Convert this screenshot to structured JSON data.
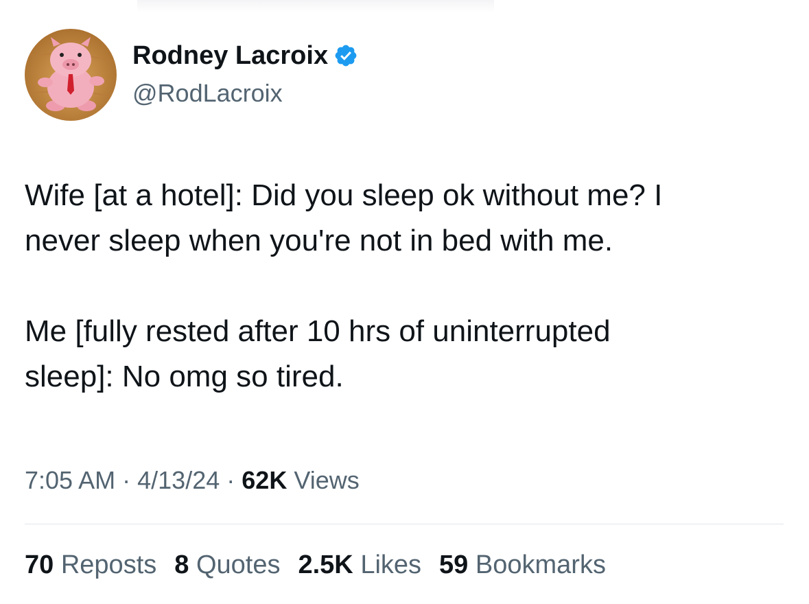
{
  "author": {
    "display_name": "Rodney Lacroix",
    "handle": "@RodLacroix",
    "verified_icon": "verified-badge-icon",
    "verified_color": "#1d9bf0"
  },
  "tweet": {
    "text": "Wife [at a hotel]: Did you sleep ok without me? I\nnever sleep when you're not in bed with me.\n\nMe [fully rested after 10 hrs of uninterrupted\nsleep]: No omg so tired."
  },
  "meta": {
    "time": "7:05 AM",
    "separator": "·",
    "date": "4/13/24",
    "views_count": "62K",
    "views_label": "Views"
  },
  "stats": {
    "reposts_count": "70",
    "reposts_label": "Reposts",
    "quotes_count": "8",
    "quotes_label": "Quotes",
    "likes_count": "2.5K",
    "likes_label": "Likes",
    "bookmarks_count": "59",
    "bookmarks_label": "Bookmarks"
  }
}
